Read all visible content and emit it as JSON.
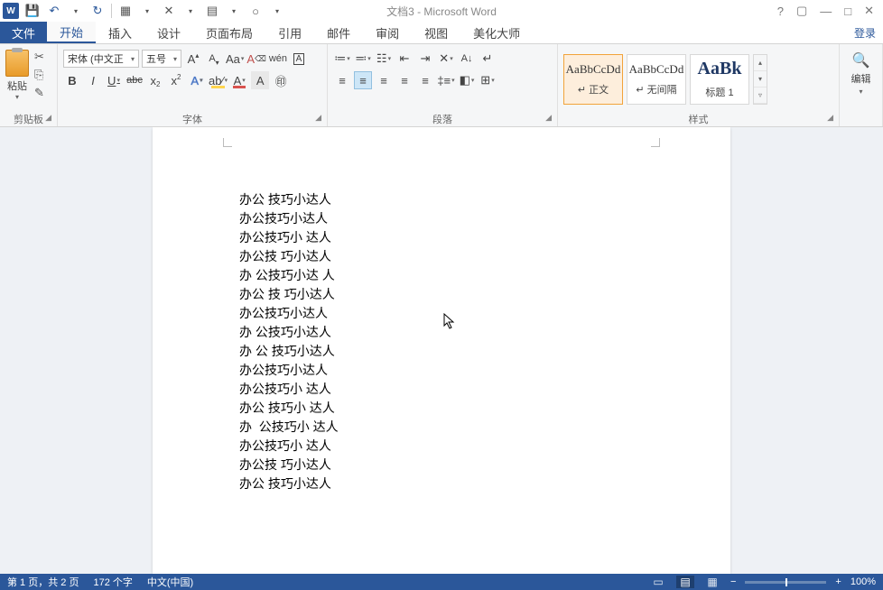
{
  "titlebar": {
    "app_icon": "W",
    "title": "文档3 - Microsoft Word",
    "help": "?",
    "ribbon_opts": "▢",
    "minimize": "—",
    "restore": "□",
    "close": "✕"
  },
  "qat": {
    "save": "💾",
    "undo": "↶",
    "redo": "↻",
    "custom1": "▦",
    "custom2": "✕",
    "custom3": "▤",
    "custom4": "○"
  },
  "tabs": {
    "file": "文件",
    "home": "开始",
    "insert": "插入",
    "design": "设计",
    "layout": "页面布局",
    "references": "引用",
    "mail": "邮件",
    "review": "审阅",
    "view": "视图",
    "beautify": "美化大师",
    "login": "登录"
  },
  "clipboard": {
    "paste": "粘贴",
    "cut": "✂",
    "copy": "⎘",
    "format_painter": "✎",
    "group_label": "剪贴板"
  },
  "font": {
    "name": "宋体 (中文正",
    "size": "五号",
    "grow": "A",
    "shrink": "A",
    "change_case": "Aa",
    "clear": "⌫",
    "phonetic": "wén",
    "char_border": "A",
    "bold": "B",
    "italic": "I",
    "underline": "U",
    "strike": "abc",
    "subscript": "x",
    "superscript": "x",
    "text_effects": "A",
    "highlight": "ab⁄",
    "font_color": "A",
    "char_shading": "A",
    "enclose": "㊞",
    "group_label": "字体"
  },
  "paragraph": {
    "bullets": "≔",
    "numbering": "≕",
    "multilevel": "☷",
    "dec_indent": "⇤",
    "inc_indent": "⇥",
    "cn_format": "✕",
    "sort": "A↓",
    "show_marks": "↵",
    "align_left": "≡",
    "align_center": "≡",
    "align_right": "≡",
    "justify": "≡",
    "distribute": "≡",
    "line_spacing": "‡≡",
    "shading": "◧",
    "borders": "⊞",
    "group_label": "段落"
  },
  "styles": {
    "preview": "AaBbCcDd",
    "normal": "↵ 正文",
    "no_spacing": "↵ 无间隔",
    "heading1": "标题 1",
    "heading1_prev": "AaBk",
    "group_label": "样式"
  },
  "editing": {
    "find": "🔍",
    "label": "编辑"
  },
  "document": {
    "lines": [
      "办公 技巧小达人",
      "办公技巧小达人",
      "办公技巧小 达人",
      "办公技 巧小达人",
      "办 公技巧小达 人",
      "办公 技 巧小达人",
      "办公技巧小达人",
      "办 公技巧小达人",
      "办 公 技巧小达人",
      "办公技巧小达人",
      "办公技巧小 达人",
      "办公 技巧小 达人",
      "办  公技巧小 达人",
      "办公技巧小 达人",
      "办公技 巧小达人",
      "办公 技巧小达人"
    ]
  },
  "statusbar": {
    "page": "第 1 页，共 2 页",
    "words": "172 个字",
    "lang": "中文(中国)",
    "zoom": "100%",
    "zoom_out": "−",
    "zoom_in": "+"
  }
}
